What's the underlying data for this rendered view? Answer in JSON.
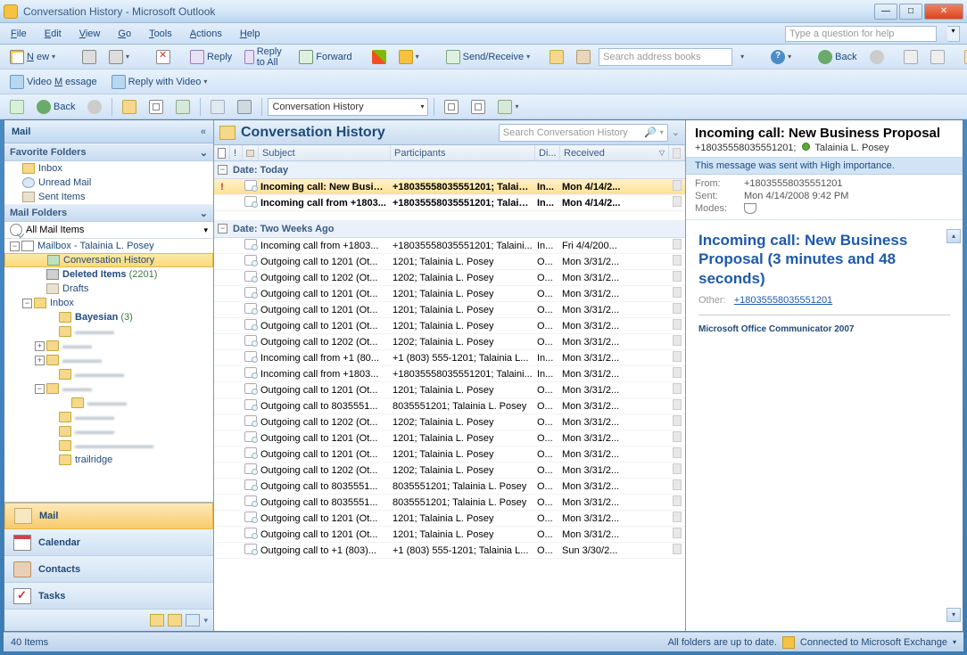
{
  "window": {
    "title": "Conversation History - Microsoft Outlook"
  },
  "menu": {
    "file": "File",
    "edit": "Edit",
    "view": "View",
    "go": "Go",
    "tools": "Tools",
    "actions": "Actions",
    "help": "Help",
    "helpbox_placeholder": "Type a question for help"
  },
  "toolbar": {
    "new": "New",
    "reply": "Reply",
    "reply_all": "Reply to All",
    "forward": "Forward",
    "send_receive": "Send/Receive",
    "search_placeholder": "Search address books",
    "back": "Back",
    "video_msg": "Video Message",
    "reply_video": "Reply with Video",
    "back2": "Back",
    "combo_value": "Conversation History"
  },
  "nav": {
    "title": "Mail",
    "fav_header": "Favorite Folders",
    "fav_inbox": "Inbox",
    "fav_unread": "Unread Mail",
    "fav_sent": "Sent Items",
    "mailfolders_header": "Mail Folders",
    "all_mail": "All Mail Items",
    "mailbox": "Mailbox - Talainia L. Posey",
    "conv_hist": "Conversation History",
    "deleted": "Deleted Items",
    "deleted_count": "(2201)",
    "drafts": "Drafts",
    "inbox": "Inbox",
    "bayesian": "Bayesian",
    "bayesian_count": "(3)",
    "trailridge": "trailridge",
    "btn_mail": "Mail",
    "btn_calendar": "Calendar",
    "btn_contacts": "Contacts",
    "btn_tasks": "Tasks"
  },
  "list": {
    "header_title": "Conversation History",
    "search_placeholder": "Search Conversation History",
    "col_subject": "Subject",
    "col_participants": "Participants",
    "col_dir": "Di...",
    "col_received": "Received",
    "group_today": "Date: Today",
    "group_twoweeks": "Date: Two Weeks Ago",
    "rows": [
      {
        "imp": "!",
        "subject": "Incoming call: New Busine...",
        "participants": "+18035558035551201; Talaini...",
        "dir": "In...",
        "received": "Mon 4/14/2...",
        "unread": true,
        "selected": true
      },
      {
        "imp": "",
        "subject": "Incoming call from +1803...",
        "participants": "+18035558035551201; Talaini...",
        "dir": "In...",
        "received": "Mon 4/14/2...",
        "unread": true
      }
    ],
    "rows2": [
      {
        "subject": "Incoming call from +1803...",
        "participants": "+18035558035551201; Talaini...",
        "dir": "In...",
        "received": "Fri 4/4/200..."
      },
      {
        "subject": "Outgoing call to 1201 (Ot...",
        "participants": "1201; Talainia L. Posey",
        "dir": "O...",
        "received": "Mon 3/31/2..."
      },
      {
        "subject": "Outgoing call to 1202 (Ot...",
        "participants": "1202; Talainia L. Posey",
        "dir": "O...",
        "received": "Mon 3/31/2..."
      },
      {
        "subject": "Outgoing call to 1201 (Ot...",
        "participants": "1201; Talainia L. Posey",
        "dir": "O...",
        "received": "Mon 3/31/2..."
      },
      {
        "subject": "Outgoing call to 1201 (Ot...",
        "participants": "1201; Talainia L. Posey",
        "dir": "O...",
        "received": "Mon 3/31/2..."
      },
      {
        "subject": "Outgoing call to 1201 (Ot...",
        "participants": "1201; Talainia L. Posey",
        "dir": "O...",
        "received": "Mon 3/31/2..."
      },
      {
        "subject": "Outgoing call to 1202 (Ot...",
        "participants": "1202; Talainia L. Posey",
        "dir": "O...",
        "received": "Mon 3/31/2..."
      },
      {
        "subject": "Incoming call from +1 (80...",
        "participants": "+1 (803) 555-1201; Talainia L...",
        "dir": "In...",
        "received": "Mon 3/31/2..."
      },
      {
        "subject": "Incoming call from +1803...",
        "participants": "+18035558035551201; Talaini...",
        "dir": "In...",
        "received": "Mon 3/31/2..."
      },
      {
        "subject": "Outgoing call to 1201 (Ot...",
        "participants": "1201; Talainia L. Posey",
        "dir": "O...",
        "received": "Mon 3/31/2..."
      },
      {
        "subject": "Outgoing call to 8035551...",
        "participants": "8035551201; Talainia L. Posey",
        "dir": "O...",
        "received": "Mon 3/31/2..."
      },
      {
        "subject": "Outgoing call to 1202 (Ot...",
        "participants": "1202; Talainia L. Posey",
        "dir": "O...",
        "received": "Mon 3/31/2..."
      },
      {
        "subject": "Outgoing call to 1201 (Ot...",
        "participants": "1201; Talainia L. Posey",
        "dir": "O...",
        "received": "Mon 3/31/2..."
      },
      {
        "subject": "Outgoing call to 1201 (Ot...",
        "participants": "1201; Talainia L. Posey",
        "dir": "O...",
        "received": "Mon 3/31/2..."
      },
      {
        "subject": "Outgoing call to 1202 (Ot...",
        "participants": "1202; Talainia L. Posey",
        "dir": "O...",
        "received": "Mon 3/31/2..."
      },
      {
        "subject": "Outgoing call to 8035551...",
        "participants": "8035551201; Talainia L. Posey",
        "dir": "O...",
        "received": "Mon 3/31/2..."
      },
      {
        "subject": "Outgoing call to 8035551...",
        "participants": "8035551201; Talainia L. Posey",
        "dir": "O...",
        "received": "Mon 3/31/2..."
      },
      {
        "subject": "Outgoing call to 1201 (Ot...",
        "participants": "1201; Talainia L. Posey",
        "dir": "O...",
        "received": "Mon 3/31/2..."
      },
      {
        "subject": "Outgoing call to 1201 (Ot...",
        "participants": "1201; Talainia L. Posey",
        "dir": "O...",
        "received": "Mon 3/31/2..."
      },
      {
        "subject": "Outgoing call to +1 (803)...",
        "participants": "+1 (803) 555-1201; Talainia L...",
        "dir": "O...",
        "received": "Sun 3/30/2..."
      }
    ]
  },
  "reading": {
    "subject": "Incoming call: New Business Proposal",
    "from_num": "+18035558035551201;",
    "from_name": "Talainia L. Posey",
    "importance": "This message was sent with High importance.",
    "lbl_from": "From:",
    "val_from": "+18035558035551201",
    "lbl_sent": "Sent:",
    "val_sent": "Mon 4/14/2008 9:42 PM",
    "lbl_modes": "Modes:",
    "body_subject": "Incoming call: New Business Proposal (3 minutes and 48 seconds)",
    "other_label": "Other:",
    "other_link": "+18035558035551201",
    "footer": "Microsoft Office Communicator 2007"
  },
  "status": {
    "left": "40 Items",
    "sync": "All folders are up to date.",
    "conn": "Connected to Microsoft Exchange"
  }
}
